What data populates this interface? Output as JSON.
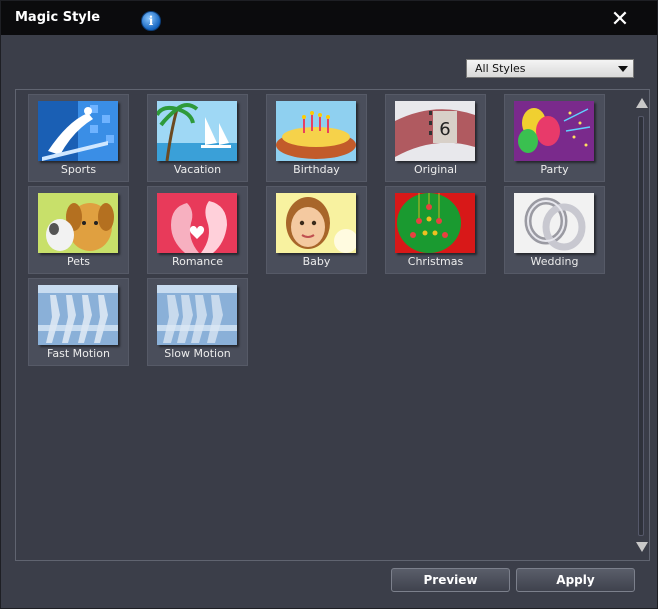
{
  "window": {
    "title": "Magic Style",
    "info_icon": "info-icon",
    "close_icon": "close-icon",
    "close_glyph": "✕",
    "info_glyph": "i"
  },
  "filter": {
    "selected": "All Styles"
  },
  "styles": [
    {
      "label": "Sports",
      "icon": "sports-thumbnail"
    },
    {
      "label": "Vacation",
      "icon": "vacation-thumbnail"
    },
    {
      "label": "Birthday",
      "icon": "birthday-thumbnail"
    },
    {
      "label": "Original",
      "icon": "original-thumbnail",
      "badge": "6"
    },
    {
      "label": "Party",
      "icon": "party-thumbnail"
    },
    {
      "label": "Pets",
      "icon": "pets-thumbnail"
    },
    {
      "label": "Romance",
      "icon": "romance-thumbnail"
    },
    {
      "label": "Baby",
      "icon": "baby-thumbnail"
    },
    {
      "label": "Christmas",
      "icon": "christmas-thumbnail"
    },
    {
      "label": "Wedding",
      "icon": "wedding-thumbnail"
    },
    {
      "label": "Fast Motion",
      "icon": "fast-motion-thumbnail"
    },
    {
      "label": "Slow Motion",
      "icon": "slow-motion-thumbnail"
    }
  ],
  "buttons": {
    "preview": "Preview",
    "apply": "Apply"
  },
  "colors": {
    "window_bg": "#3b3e49",
    "titlebar_bg": "#0b0b0d",
    "tile_bg": "#4a4e5b"
  }
}
